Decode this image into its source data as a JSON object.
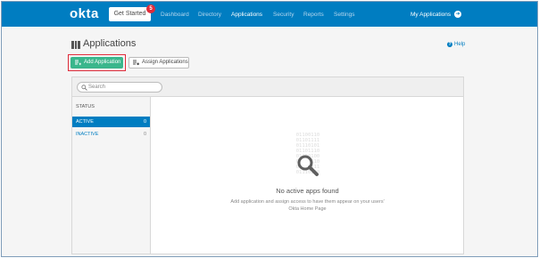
{
  "topbar": {
    "logo": "okta",
    "get_started": "Get Started",
    "get_started_badge": "5",
    "nav": [
      {
        "label": "Dashboard"
      },
      {
        "label": "Directory"
      },
      {
        "label": "Applications"
      },
      {
        "label": "Security"
      },
      {
        "label": "Reports"
      },
      {
        "label": "Settings"
      }
    ],
    "active_nav": "Applications",
    "my_applications": "My Applications",
    "my_applications_icon": "arrow-right-circle-icon"
  },
  "header": {
    "title": "Applications",
    "title_icon": "grid-icon",
    "help": "Help",
    "help_icon": "help-circle-icon"
  },
  "toolbar": {
    "add_label": "Add Application",
    "assign_label": "Assign Applications"
  },
  "search": {
    "placeholder": "Search"
  },
  "sidebar": {
    "heading": "STATUS",
    "filters": [
      {
        "label": "ACTIVE",
        "count": "0"
      },
      {
        "label": "INACTIVE",
        "count": "0"
      }
    ]
  },
  "empty_state": {
    "binary": [
      "01100110",
      "01101111",
      "01110101",
      "01101110",
      "01100100",
      "01101110",
      "01101111",
      "01110100"
    ],
    "title": "No active apps found",
    "line1": "Add application and assign access to have them appear on your users'",
    "line2": "Okta Home Page"
  },
  "colors": {
    "brand": "#007dc1",
    "add_button": "#3ab68c",
    "highlight": "#e02b3a"
  }
}
